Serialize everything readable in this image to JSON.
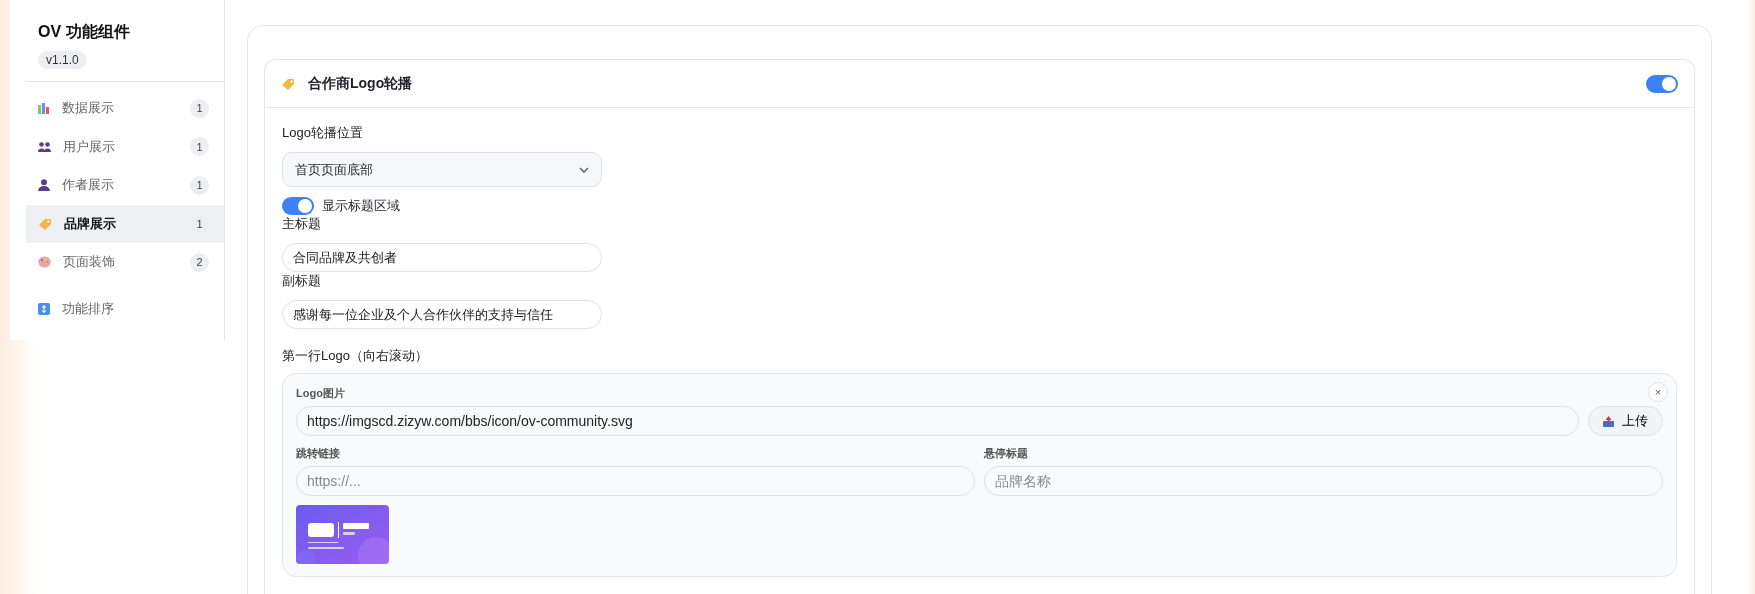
{
  "sidebar": {
    "title": "OV 功能组件",
    "version": "v1.1.0",
    "items": [
      {
        "kind": "chart",
        "label": "数据展示",
        "count": "1",
        "selected": false
      },
      {
        "kind": "users",
        "label": "用户展示",
        "count": "1",
        "selected": false
      },
      {
        "kind": "user",
        "label": "作者展示",
        "count": "1",
        "selected": false
      },
      {
        "kind": "tag",
        "label": "品牌展示",
        "count": "1",
        "selected": true
      },
      {
        "kind": "palette",
        "label": "页面装饰",
        "count": "2",
        "selected": false
      }
    ],
    "footer_item": {
      "kind": "sort",
      "label": "功能排序"
    }
  },
  "panel": {
    "title": "合作商Logo轮播",
    "enabled": true,
    "position_label": "Logo轮播位置",
    "position_value": "首页页面底部",
    "show_title": {
      "label": "显示标题区域",
      "on": true
    },
    "main_title": {
      "label": "主标题",
      "value": "合同品牌及共创者"
    },
    "subtitle": {
      "label": "副标题",
      "value": "感谢每一位企业及个人合作伙伴的支持与信任"
    },
    "row_label": "第一行Logo（向右滚动）",
    "logos": [
      {
        "remove_symbol": "×",
        "image_label": "Logo图片",
        "image_url": "https://imgscd.zizyw.com/bbs/icon/ov-community.svg",
        "upload_label": "上传",
        "link_label": "跳转链接",
        "link_placeholder": "https://...",
        "hover_label": "悬停标题",
        "hover_placeholder": "品牌名称"
      }
    ]
  }
}
